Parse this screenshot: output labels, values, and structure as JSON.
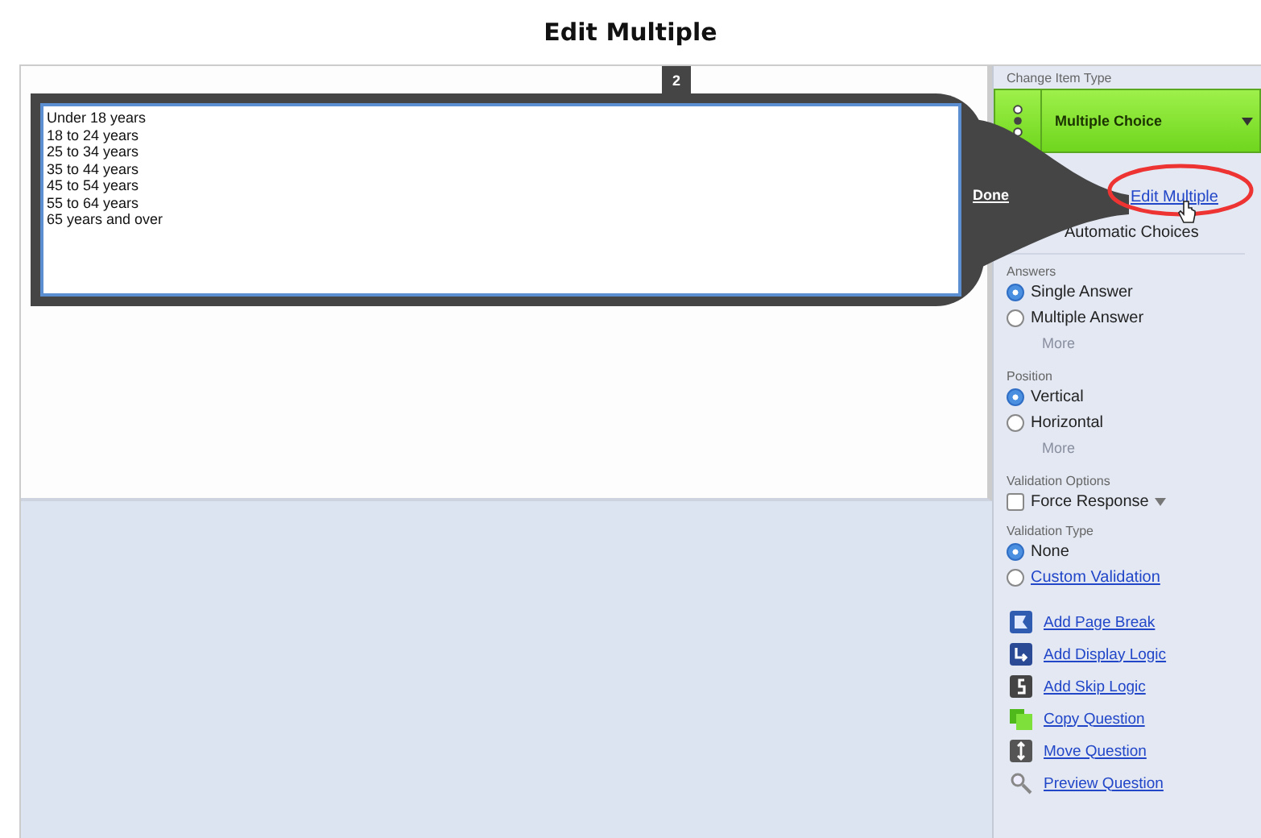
{
  "page_title": "Edit Multiple",
  "editor": {
    "tab": "2",
    "choices": [
      "Under 18 years",
      "18 to 24 years",
      "25 to 34 years",
      "35 to 44 years",
      "45 to 54 years",
      "55 to 64 years",
      "65 years and over"
    ],
    "done": "Done"
  },
  "sidebar": {
    "item_type": {
      "label": "Change Item Type",
      "value": "Multiple Choice"
    },
    "edit_multiple": "Edit Multiple",
    "automatic_choices": {
      "label": "Automatic Choices"
    },
    "answers": {
      "label": "Answers",
      "options": [
        {
          "label": "Single Answer",
          "selected": true
        },
        {
          "label": "Multiple Answer",
          "selected": false
        }
      ],
      "more": "More"
    },
    "position": {
      "label": "Position",
      "options": [
        {
          "label": "Vertical",
          "selected": true
        },
        {
          "label": "Horizontal",
          "selected": false
        }
      ],
      "more": "More"
    },
    "validation_options": {
      "label": "Validation Options",
      "force_response": {
        "label": "Force Response",
        "checked": false
      }
    },
    "validation_type": {
      "label": "Validation Type",
      "options": [
        {
          "label": "None",
          "selected": true,
          "kind": "plain"
        },
        {
          "label": "Custom Validation",
          "selected": false,
          "kind": "link"
        }
      ]
    },
    "actions": [
      {
        "label": "Add Page Break",
        "kind": "page-break"
      },
      {
        "label": "Add Display Logic",
        "kind": "display-logic"
      },
      {
        "label": "Add Skip Logic",
        "kind": "skip-logic"
      },
      {
        "label": "Copy Question",
        "kind": "copy"
      },
      {
        "label": "Move Question",
        "kind": "move"
      },
      {
        "label": "Preview Question",
        "kind": "preview"
      }
    ]
  }
}
